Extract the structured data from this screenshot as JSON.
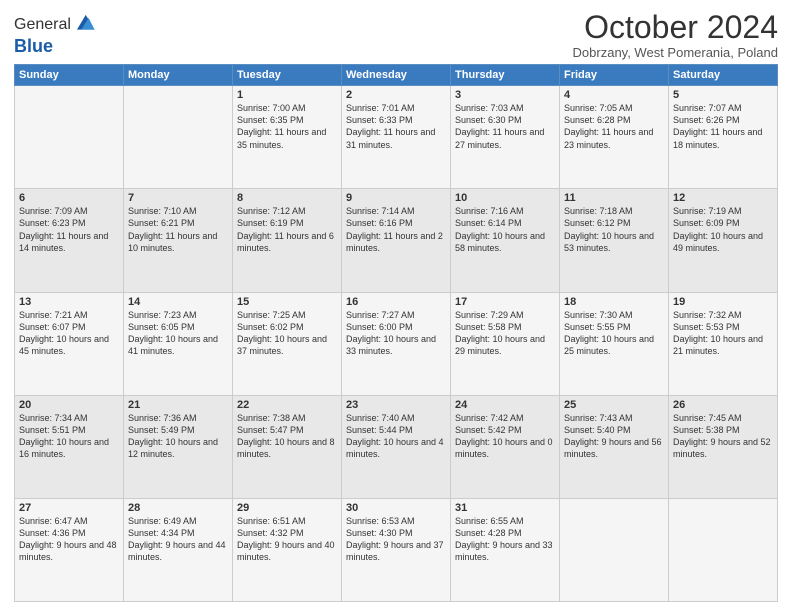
{
  "header": {
    "logo_line1": "General",
    "logo_line2": "Blue",
    "month_year": "October 2024",
    "location": "Dobrzany, West Pomerania, Poland"
  },
  "days_of_week": [
    "Sunday",
    "Monday",
    "Tuesday",
    "Wednesday",
    "Thursday",
    "Friday",
    "Saturday"
  ],
  "weeks": [
    [
      {
        "day": "",
        "text": ""
      },
      {
        "day": "",
        "text": ""
      },
      {
        "day": "1",
        "text": "Sunrise: 7:00 AM\nSunset: 6:35 PM\nDaylight: 11 hours and 35 minutes."
      },
      {
        "day": "2",
        "text": "Sunrise: 7:01 AM\nSunset: 6:33 PM\nDaylight: 11 hours and 31 minutes."
      },
      {
        "day": "3",
        "text": "Sunrise: 7:03 AM\nSunset: 6:30 PM\nDaylight: 11 hours and 27 minutes."
      },
      {
        "day": "4",
        "text": "Sunrise: 7:05 AM\nSunset: 6:28 PM\nDaylight: 11 hours and 23 minutes."
      },
      {
        "day": "5",
        "text": "Sunrise: 7:07 AM\nSunset: 6:26 PM\nDaylight: 11 hours and 18 minutes."
      }
    ],
    [
      {
        "day": "6",
        "text": "Sunrise: 7:09 AM\nSunset: 6:23 PM\nDaylight: 11 hours and 14 minutes."
      },
      {
        "day": "7",
        "text": "Sunrise: 7:10 AM\nSunset: 6:21 PM\nDaylight: 11 hours and 10 minutes."
      },
      {
        "day": "8",
        "text": "Sunrise: 7:12 AM\nSunset: 6:19 PM\nDaylight: 11 hours and 6 minutes."
      },
      {
        "day": "9",
        "text": "Sunrise: 7:14 AM\nSunset: 6:16 PM\nDaylight: 11 hours and 2 minutes."
      },
      {
        "day": "10",
        "text": "Sunrise: 7:16 AM\nSunset: 6:14 PM\nDaylight: 10 hours and 58 minutes."
      },
      {
        "day": "11",
        "text": "Sunrise: 7:18 AM\nSunset: 6:12 PM\nDaylight: 10 hours and 53 minutes."
      },
      {
        "day": "12",
        "text": "Sunrise: 7:19 AM\nSunset: 6:09 PM\nDaylight: 10 hours and 49 minutes."
      }
    ],
    [
      {
        "day": "13",
        "text": "Sunrise: 7:21 AM\nSunset: 6:07 PM\nDaylight: 10 hours and 45 minutes."
      },
      {
        "day": "14",
        "text": "Sunrise: 7:23 AM\nSunset: 6:05 PM\nDaylight: 10 hours and 41 minutes."
      },
      {
        "day": "15",
        "text": "Sunrise: 7:25 AM\nSunset: 6:02 PM\nDaylight: 10 hours and 37 minutes."
      },
      {
        "day": "16",
        "text": "Sunrise: 7:27 AM\nSunset: 6:00 PM\nDaylight: 10 hours and 33 minutes."
      },
      {
        "day": "17",
        "text": "Sunrise: 7:29 AM\nSunset: 5:58 PM\nDaylight: 10 hours and 29 minutes."
      },
      {
        "day": "18",
        "text": "Sunrise: 7:30 AM\nSunset: 5:55 PM\nDaylight: 10 hours and 25 minutes."
      },
      {
        "day": "19",
        "text": "Sunrise: 7:32 AM\nSunset: 5:53 PM\nDaylight: 10 hours and 21 minutes."
      }
    ],
    [
      {
        "day": "20",
        "text": "Sunrise: 7:34 AM\nSunset: 5:51 PM\nDaylight: 10 hours and 16 minutes."
      },
      {
        "day": "21",
        "text": "Sunrise: 7:36 AM\nSunset: 5:49 PM\nDaylight: 10 hours and 12 minutes."
      },
      {
        "day": "22",
        "text": "Sunrise: 7:38 AM\nSunset: 5:47 PM\nDaylight: 10 hours and 8 minutes."
      },
      {
        "day": "23",
        "text": "Sunrise: 7:40 AM\nSunset: 5:44 PM\nDaylight: 10 hours and 4 minutes."
      },
      {
        "day": "24",
        "text": "Sunrise: 7:42 AM\nSunset: 5:42 PM\nDaylight: 10 hours and 0 minutes."
      },
      {
        "day": "25",
        "text": "Sunrise: 7:43 AM\nSunset: 5:40 PM\nDaylight: 9 hours and 56 minutes."
      },
      {
        "day": "26",
        "text": "Sunrise: 7:45 AM\nSunset: 5:38 PM\nDaylight: 9 hours and 52 minutes."
      }
    ],
    [
      {
        "day": "27",
        "text": "Sunrise: 6:47 AM\nSunset: 4:36 PM\nDaylight: 9 hours and 48 minutes."
      },
      {
        "day": "28",
        "text": "Sunrise: 6:49 AM\nSunset: 4:34 PM\nDaylight: 9 hours and 44 minutes."
      },
      {
        "day": "29",
        "text": "Sunrise: 6:51 AM\nSunset: 4:32 PM\nDaylight: 9 hours and 40 minutes."
      },
      {
        "day": "30",
        "text": "Sunrise: 6:53 AM\nSunset: 4:30 PM\nDaylight: 9 hours and 37 minutes."
      },
      {
        "day": "31",
        "text": "Sunrise: 6:55 AM\nSunset: 4:28 PM\nDaylight: 9 hours and 33 minutes."
      },
      {
        "day": "",
        "text": ""
      },
      {
        "day": "",
        "text": ""
      }
    ]
  ]
}
